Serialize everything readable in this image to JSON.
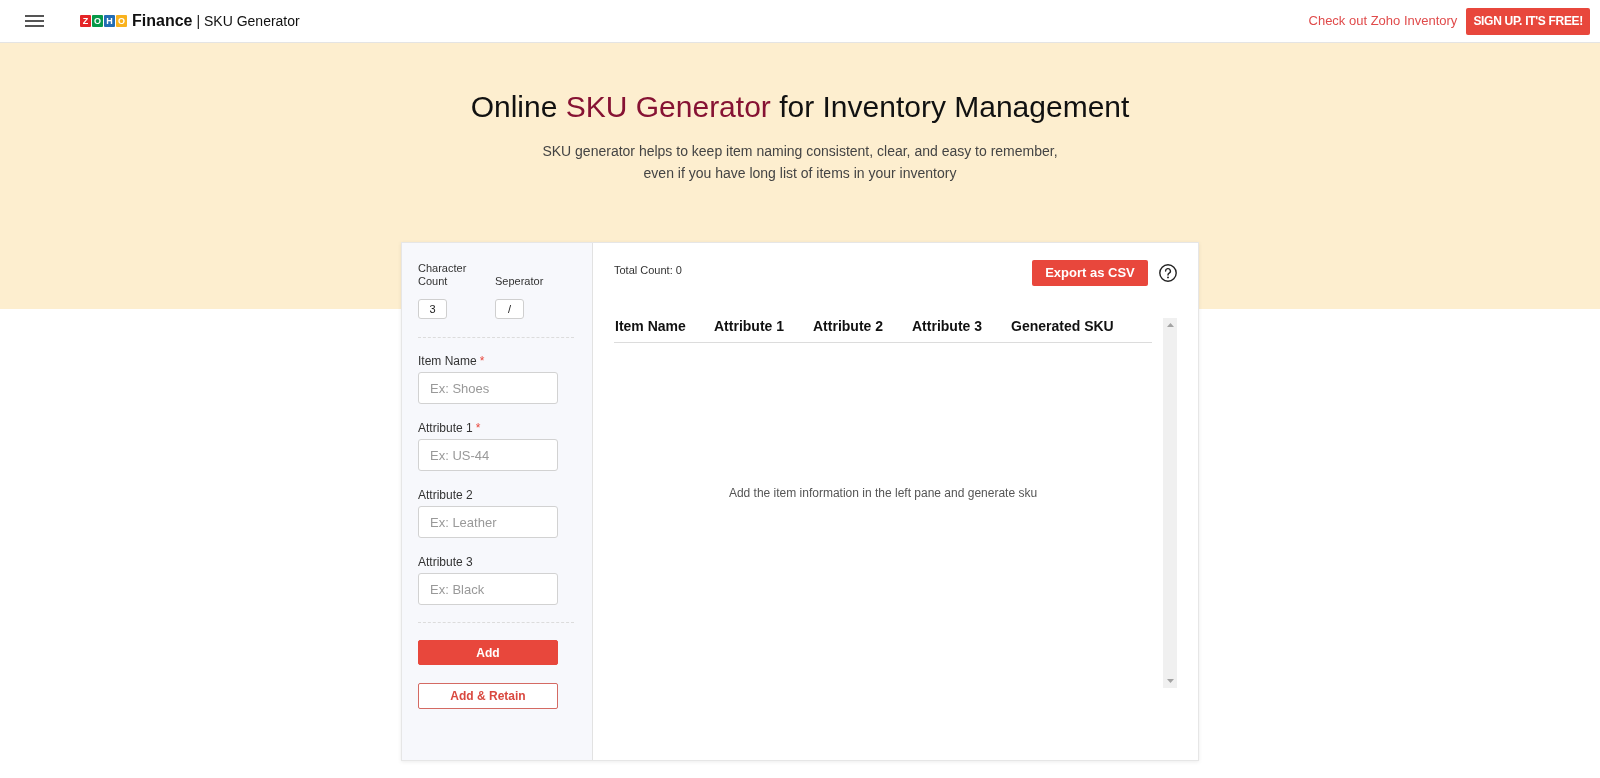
{
  "header": {
    "logo": {
      "tiles": [
        {
          "letter": "Z",
          "color": "#e42527"
        },
        {
          "letter": "O",
          "color": "#089949"
        },
        {
          "letter": "H",
          "color": "#226db4"
        },
        {
          "letter": "O",
          "color": "#f9b21d"
        }
      ],
      "product": "Finance",
      "app": "| SKU Generator"
    },
    "link": "Check out Zoho Inventory",
    "signup_button": "SIGN UP. IT'S FREE!"
  },
  "hero": {
    "title": [
      {
        "text": "Online ",
        "accent": false
      },
      {
        "text": "SKU Generator",
        "accent": true
      },
      {
        "text": " for Inventory Management",
        "accent": false
      }
    ],
    "subtitle": "SKU generator helps to keep item naming consistent, clear, and easy to remember, even if you have long list of items in your inventory"
  },
  "settings": [
    {
      "label": "Character Count",
      "value": "3"
    },
    {
      "label": "Seperator",
      "value": "/"
    }
  ],
  "fields": [
    {
      "label": "Item Name",
      "required_mark": "*",
      "placeholder": "Ex: Shoes"
    },
    {
      "label": "Attribute 1",
      "required_mark": "*",
      "placeholder": "Ex: US-44"
    },
    {
      "label": "Attribute 2",
      "placeholder": "Ex: Leather"
    },
    {
      "label": "Attribute 3",
      "placeholder": "Ex: Black"
    }
  ],
  "actions": [
    {
      "label": "Add",
      "kind": "primary"
    },
    {
      "label": "Add & Retain",
      "kind": "outline"
    }
  ],
  "results": {
    "total_count": "Total Count: 0",
    "export_button": "Export as CSV",
    "table": {
      "columns": [
        "Item Name",
        "Attribute 1",
        "Attribute 2",
        "Attribute 3",
        "Generated SKU"
      ],
      "empty_message": "Add the item information in the left pane and generate sku"
    }
  }
}
